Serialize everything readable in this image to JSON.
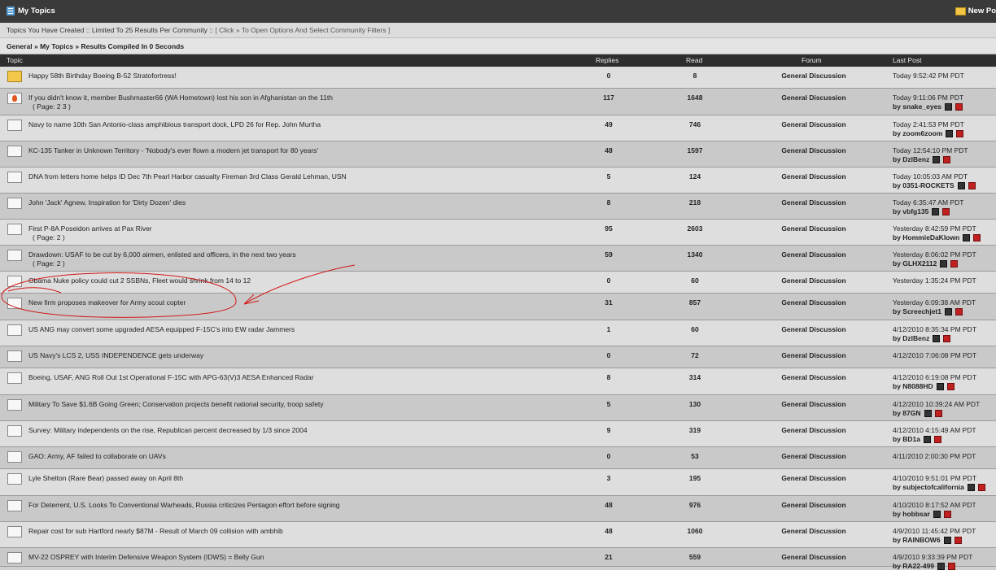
{
  "window": {
    "title": "My Topics",
    "new_posts": "New Po"
  },
  "info": {
    "text": "Topics You Have Created :: Limited To 25 Results Per Community :: ",
    "filter_link": "[ Click » To Open Options And Select Community Filters ]"
  },
  "breadcrumb": {
    "text": "General » My Topics » Results Compiled In 0 Seconds"
  },
  "columns": {
    "topic": "Topic",
    "replies": "Replies",
    "read": "Read",
    "forum": "Forum",
    "last_post": "Last Post"
  },
  "rows": [
    {
      "topic": "Happy 58th Birthday Boeing B-52 Stratofortress!",
      "pages": "",
      "replies": "0",
      "read": "8",
      "forum": "General Discussion",
      "last_post": "Today 9:52:42 PM PDT",
      "by": "",
      "icon": "yellow-folder-icon"
    },
    {
      "topic": "If you didn't know it, member Bushmaster66 (WA Hometown) lost his son in Afghanistan on the 11th",
      "pages": "( Page: 2  3 )",
      "replies": "117",
      "read": "1648",
      "forum": "General Discussion",
      "last_post": "Today 9:11:06 PM PDT",
      "by": "by snake_eyes",
      "icon": "hot-folder-icon"
    },
    {
      "topic": "Navy to name 10th San Antonio-class amphibious transport dock, LPD 26 for Rep. John Murtha",
      "pages": "",
      "replies": "49",
      "read": "746",
      "forum": "General Discussion",
      "last_post": "Today 2:41:53 PM PDT",
      "by": "by zoom6zoom",
      "icon": "folder-icon"
    },
    {
      "topic": "KC-135 Tanker in Unknown Territory - 'Nobody's ever flown a modern jet transport for 80 years'",
      "pages": "",
      "replies": "48",
      "read": "1597",
      "forum": "General Discussion",
      "last_post": "Today 12:54:10 PM PDT",
      "by": "by DzlBenz",
      "icon": "folder-icon"
    },
    {
      "topic": "DNA from letters home helps ID Dec 7th Pearl Harbor casualty Fireman 3rd Class Gerald Lehman, USN",
      "pages": "",
      "replies": "5",
      "read": "124",
      "forum": "General Discussion",
      "last_post": "Today 10:05:03 AM PDT",
      "by": "by 0351-ROCKETS",
      "icon": "folder-icon"
    },
    {
      "topic": "John 'Jack' Agnew, Inspiration for 'Dirty Dozen' dies",
      "pages": "",
      "replies": "8",
      "read": "218",
      "forum": "General Discussion",
      "last_post": "Today 6:35:47 AM PDT",
      "by": "by vbfg135",
      "icon": "folder-icon"
    },
    {
      "topic": "First P-8A Poseidon arrives at Pax River",
      "pages": "( Page: 2 )",
      "replies": "95",
      "read": "2603",
      "forum": "General Discussion",
      "last_post": "Yesterday 8:42:59 PM PDT",
      "by": "by HommieDaKlown",
      "icon": "folder-icon"
    },
    {
      "topic": "Drawdown: USAF to be cut by 6,000 airmen, enlisted and officers, in the next two years",
      "pages": "( Page: 2 )",
      "replies": "59",
      "read": "1340",
      "forum": "General Discussion",
      "last_post": "Yesterday 8:06:02 PM PDT",
      "by": "by GLHX2112",
      "icon": "folder-icon"
    },
    {
      "topic": "Obama Nuke policy could cut 2 SSBNs, Fleet would shrink from 14 to 12",
      "pages": "",
      "replies": "0",
      "read": "60",
      "forum": "General Discussion",
      "last_post": "Yesterday 1:35:24 PM PDT",
      "by": "",
      "icon": "folder-icon"
    },
    {
      "topic": "New firm proposes makeover for Army scout copter",
      "pages": "",
      "replies": "31",
      "read": "857",
      "forum": "General Discussion",
      "last_post": "Yesterday 6:09:38 AM PDT",
      "by": "by Screechjet1",
      "icon": "folder-icon"
    },
    {
      "topic": "US ANG may convert some upgraded AESA equipped F-15C's into EW radar Jammers",
      "pages": "",
      "replies": "1",
      "read": "60",
      "forum": "General Discussion",
      "last_post": "4/12/2010 8:35:34 PM PDT",
      "by": "by DzlBenz",
      "icon": "folder-icon"
    },
    {
      "topic": "US Navy's LCS 2, USS INDEPENDENCE gets underway",
      "pages": "",
      "replies": "0",
      "read": "72",
      "forum": "General Discussion",
      "last_post": "4/12/2010 7:06:08 PM PDT",
      "by": "",
      "icon": "folder-icon"
    },
    {
      "topic": "Boeing, USAF, ANG Roll Out 1st Operational F-15C with APG-63(V)3 AESA Enhanced Radar",
      "pages": "",
      "replies": "8",
      "read": "314",
      "forum": "General Discussion",
      "last_post": "4/12/2010 6:19:08 PM PDT",
      "by": "by N8088HD",
      "icon": "folder-icon"
    },
    {
      "topic": "Military To Save $1.6B Going Green; Conservation projects benefit national security, troop safety",
      "pages": "",
      "replies": "5",
      "read": "130",
      "forum": "General Discussion",
      "last_post": "4/12/2010 10:39:24 AM PDT",
      "by": "by 87GN",
      "icon": "folder-icon"
    },
    {
      "topic": "Survey: Military independents on the rise, Republican percent decreased by 1/3 since 2004",
      "pages": "",
      "replies": "9",
      "read": "319",
      "forum": "General Discussion",
      "last_post": "4/12/2010 4:15:49 AM PDT",
      "by": "by BD1a",
      "icon": "folder-icon"
    },
    {
      "topic": "GAO: Army, AF failed to collaborate on UAVs",
      "pages": "",
      "replies": "0",
      "read": "53",
      "forum": "General Discussion",
      "last_post": "4/11/2010 2:00:30 PM PDT",
      "by": "",
      "icon": "folder-icon"
    },
    {
      "topic": "Lyle Shelton (Rare Bear) passed away on April 8th",
      "pages": "",
      "replies": "3",
      "read": "195",
      "forum": "General Discussion",
      "last_post": "4/10/2010 9:51:01 PM PDT",
      "by": "by subjectofcalifornia",
      "icon": "folder-icon"
    },
    {
      "topic": "For Deterrent, U.S. Looks To Conventional Warheads, Russia criticizes Pentagon effort before signing",
      "pages": "",
      "replies": "48",
      "read": "976",
      "forum": "General Discussion",
      "last_post": "4/10/2010 8:17:52 AM PDT",
      "by": "by hobbsar",
      "icon": "folder-icon"
    },
    {
      "topic": "Repair cost for sub Hartford nearly $87M - Result of March 09 collision with ambhib",
      "pages": "",
      "replies": "48",
      "read": "1060",
      "forum": "General Discussion",
      "last_post": "4/9/2010 11:45:42 PM PDT",
      "by": "by RAINBOW6",
      "icon": "folder-icon"
    },
    {
      "topic": "MV-22 OSPREY with Interim Defensive Weapon System (IDWS) = Belly Gun",
      "pages": "",
      "replies": "21",
      "read": "559",
      "forum": "General Discussion",
      "last_post": "4/9/2010 9:33:39 PM PDT",
      "by": "by RA22-499",
      "icon": "folder-icon"
    }
  ]
}
